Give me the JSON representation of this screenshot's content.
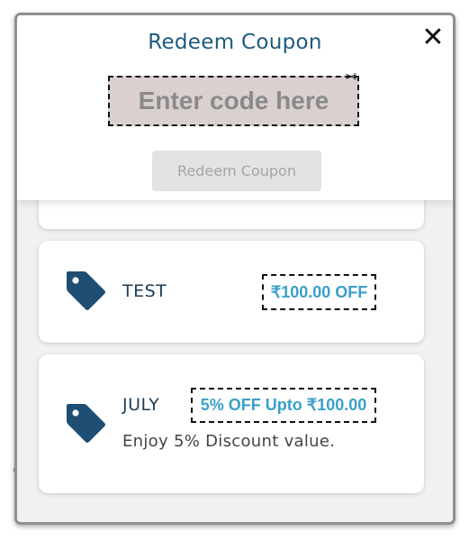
{
  "modal": {
    "title": "Redeem Coupon",
    "close_symbol": "✕",
    "code_input": {
      "placeholder": "Enter code here",
      "value": ""
    },
    "redeem_button_label": "Redeem Coupon"
  },
  "coupons": [
    {
      "code": "TEST",
      "offer": "₹100.00 OFF",
      "description": ""
    },
    {
      "code": "JULY",
      "offer": "5% OFF Upto ₹100.00",
      "description": "Enjoy 5% Discount value."
    }
  ],
  "colors": {
    "title": "#1e5a7e",
    "tag_icon": "#1e4e73",
    "offer_text": "#3aa0c9",
    "input_bg": "#dbd0d0",
    "button_disabled_bg": "#e3e3e3"
  },
  "icons": [
    "close-icon",
    "scissors-icon",
    "tag-icon"
  ]
}
